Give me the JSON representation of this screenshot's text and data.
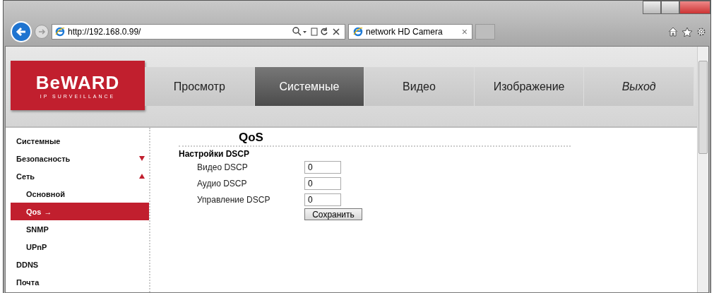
{
  "browser": {
    "address": "http://192.168.0.99/",
    "tabs": [
      {
        "label": "network HD Camera",
        "selected": true
      }
    ],
    "tab_close": "×"
  },
  "logo": {
    "name": "BeWARD",
    "tagline": "IP SURVEILLANCE"
  },
  "nav": [
    {
      "label": "Просмотр",
      "selected": false,
      "italic": false
    },
    {
      "label": "Системные",
      "selected": true,
      "italic": false
    },
    {
      "label": "Видео",
      "selected": false,
      "italic": false
    },
    {
      "label": "Изображение",
      "selected": false,
      "italic": false
    },
    {
      "label": "Выход",
      "selected": false,
      "italic": true
    }
  ],
  "sidebar": {
    "items": [
      {
        "label": "Системные",
        "selected": false
      },
      {
        "label": "Безопасность",
        "selected": false,
        "expanded": false
      },
      {
        "label": "Сеть",
        "selected": false,
        "expanded": true,
        "children": [
          {
            "label": "Основной",
            "selected": false
          },
          {
            "label": "Qos",
            "selected": true,
            "arrow": "→"
          },
          {
            "label": "SNMP",
            "selected": false
          },
          {
            "label": "UPnP",
            "selected": false
          }
        ]
      },
      {
        "label": "DDNS",
        "selected": false
      },
      {
        "label": "Почта",
        "selected": false
      }
    ]
  },
  "main": {
    "title": "QoS",
    "section": "Настройки DSCP",
    "fields": [
      {
        "label": "Видео DSCP",
        "value": "0"
      },
      {
        "label": "Аудио DSCP",
        "value": "0"
      },
      {
        "label": "Управление DSCP",
        "value": "0"
      }
    ],
    "save": "Сохранить"
  }
}
